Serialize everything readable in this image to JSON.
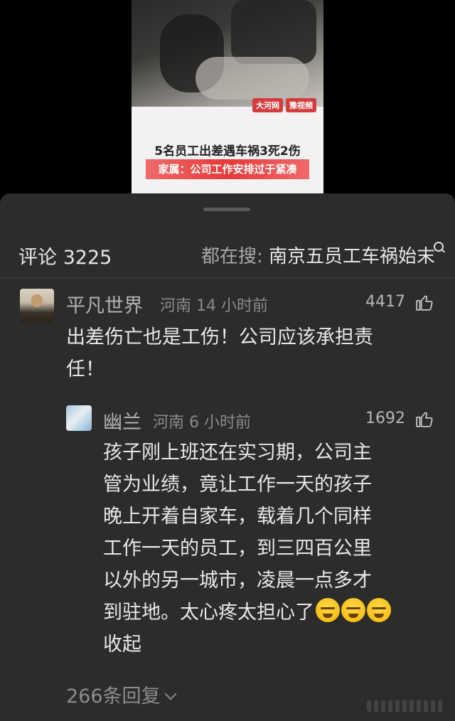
{
  "video": {
    "logo_1": "大河网",
    "logo_2": "豫视频",
    "headline": "5名员工出差遇车祸3死2伤",
    "subheadline": "家属：公司工作安排过于紧凑"
  },
  "header": {
    "comment_count": "评论 3225",
    "trending_prefix": "都在搜: ",
    "trending_query": "南京五员工车祸始末"
  },
  "comments": [
    {
      "username": "平凡世界",
      "location_time": "河南 14 小时前",
      "likes": "4417",
      "text_lines": [
        "出差伤亡也是工伤！公司应该承担责",
        "任！"
      ]
    }
  ],
  "reply": {
    "username": "幽兰",
    "location_time": "河南 6 小时前",
    "likes": "1692",
    "text_lines": [
      "孩子刚上班还在实习期，公司主",
      "管为业绩，竟让工作一天的孩子",
      "晚上开着自家车，载着几个同样",
      "工作一天的员工，到三四百公里",
      "以外的另一城市，凌晨一点多才",
      "到驻地。太心疼太担心了"
    ],
    "emojis": [
      "crying-face",
      "crying-face",
      "crying-face"
    ],
    "collapse_label": "收起"
  },
  "replies_link": "266条回复",
  "icons": {
    "like": "thumb-up-icon",
    "search": "search-icon",
    "expand": "chevron-down-icon"
  },
  "colors": {
    "panel_bg": "#2c2c2c",
    "text_primary": "#e8e8e8",
    "text_secondary": "#8a8a8a",
    "brand_red": "#e53a3a"
  }
}
